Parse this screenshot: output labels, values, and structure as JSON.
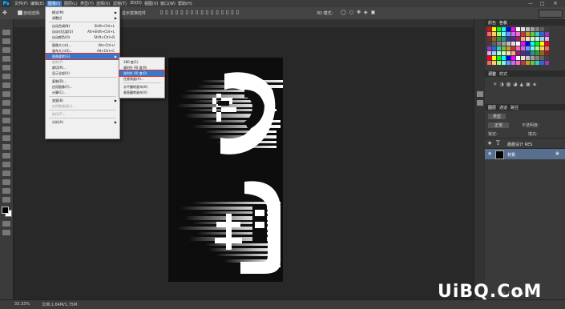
{
  "app": {
    "logo": "Ps"
  },
  "menubar": {
    "items": [
      "文件(F)",
      "编辑(E)",
      "图像(I)",
      "图层(L)",
      "类型(Y)",
      "选择(S)",
      "滤镜(T)",
      "3D(D)",
      "视图(V)",
      "窗口(W)",
      "帮助(H)"
    ]
  },
  "options": {
    "auto_select": "自动选择:",
    "layer_label": "图层",
    "transform_controls": "显示变换控件",
    "mode_3d": "3D 模式:"
  },
  "image_menu": {
    "items": [
      {
        "label": "模式(M)",
        "shortcut": "",
        "submenu": true
      },
      {
        "label": "调整(J)",
        "shortcut": "",
        "submenu": true
      },
      {
        "sep": true
      },
      {
        "label": "自动色调(N)",
        "shortcut": "Shift+Ctrl+L"
      },
      {
        "label": "自动对比度(U)",
        "shortcut": "Alt+Shift+Ctrl+L"
      },
      {
        "label": "自动颜色(O)",
        "shortcut": "Shift+Ctrl+B"
      },
      {
        "sep": true
      },
      {
        "label": "图像大小(I)...",
        "shortcut": "Alt+Ctrl+I"
      },
      {
        "label": "画布大小(S)...",
        "shortcut": "Alt+Ctrl+C"
      },
      {
        "label": "图像旋转(G)",
        "shortcut": "",
        "submenu": true,
        "highlighted": true
      },
      {
        "label": "裁剪(P)",
        "shortcut": "",
        "disabled": true
      },
      {
        "label": "裁切(R)...",
        "shortcut": ""
      },
      {
        "label": "显示全部(V)",
        "shortcut": ""
      },
      {
        "sep": true
      },
      {
        "label": "复制(D)...",
        "shortcut": ""
      },
      {
        "label": "应用图像(Y)...",
        "shortcut": ""
      },
      {
        "label": "计算(C)...",
        "shortcut": ""
      },
      {
        "sep": true
      },
      {
        "label": "变量(B)",
        "shortcut": "",
        "submenu": true
      },
      {
        "label": "应用数据组(L)...",
        "shortcut": "",
        "disabled": true
      },
      {
        "sep": true
      },
      {
        "label": "陷印(T)...",
        "shortcut": "",
        "disabled": true
      },
      {
        "sep": true
      },
      {
        "label": "分析(A)",
        "shortcut": "",
        "submenu": true
      }
    ]
  },
  "rotate_submenu": {
    "items": [
      {
        "label": "180 度(1)"
      },
      {
        "label": "顺时针 90 度(9)"
      },
      {
        "label": "逆时针 90 度(0)",
        "highlighted": true
      },
      {
        "label": "任意角度(A)..."
      },
      {
        "sep": true
      },
      {
        "label": "水平翻转画布(H)"
      },
      {
        "label": "垂直翻转画布(V)"
      }
    ]
  },
  "panels": {
    "color_tabs": [
      "颜色",
      "色板"
    ],
    "adjust_tabs": [
      "调整",
      "样式"
    ],
    "layers_tabs": [
      "图层",
      "通道",
      "路径"
    ],
    "kind_label": "类型",
    "blend_mode": "正常",
    "opacity_label": "不透明度:",
    "lock_label": "锁定:",
    "fill_label": "填充:",
    "layers": [
      {
        "name": "趣趣设计 RES",
        "type": "text"
      },
      {
        "name": "背景",
        "type": "image",
        "selected": true
      }
    ]
  },
  "status": {
    "zoom": "33.33%",
    "doc": "文档:1.64M/1.75M"
  },
  "watermark": "UiBQ.CoM",
  "colors": {
    "accent": "#3a77c9",
    "highlight_border": "#e0322c"
  }
}
